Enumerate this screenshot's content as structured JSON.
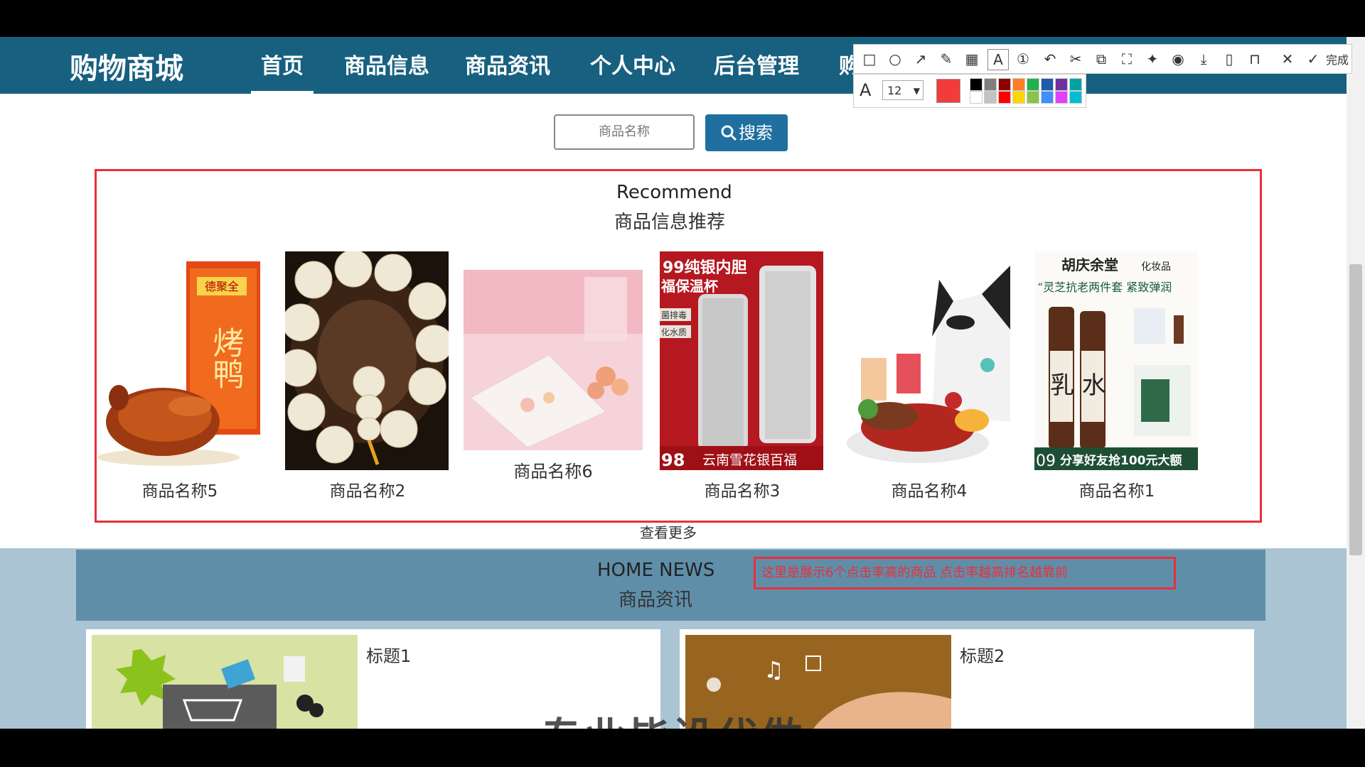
{
  "nav": {
    "logo": "购物商城",
    "items": [
      "首页",
      "商品信息",
      "商品资讯",
      "个人中心",
      "后台管理",
      "购"
    ]
  },
  "search": {
    "placeholder": "商品名称",
    "button_label": "搜索"
  },
  "recommend": {
    "title_en": "Recommend",
    "title_cn": "商品信息推荐",
    "products": [
      {
        "name": "商品名称5",
        "image": "roast-duck"
      },
      {
        "name": "商品名称2",
        "image": "bead-bracelet"
      },
      {
        "name": "商品名称6",
        "image": "pink-dessert"
      },
      {
        "name": "商品名称3",
        "image": "silver-thermos"
      },
      {
        "name": "商品名称4",
        "image": "snack-cat"
      },
      {
        "name": "商品名称1",
        "image": "cosmetics"
      }
    ],
    "more_label": "查看更多"
  },
  "product_text": {
    "duck_box": "烤鸭",
    "duck_brand": "德聚全",
    "thermos_top": "99纯银内胆",
    "thermos_sub": "福保温杯",
    "thermos_tag1": "菌排毒",
    "thermos_tag2": "化水质",
    "thermos_bottom": "云南雪花银百福",
    "thermos_price": "98",
    "cosmetics_brand": "胡庆余堂",
    "cosmetics_cat": "化妆品",
    "cosmetics_slogan": "“灵芝抗老两件套 紧致弹润",
    "cosmetics_label": "乳 水",
    "cosmetics_promo": "分享好友抢100元大额",
    "cosmetics_num": "09"
  },
  "news": {
    "title_en": "HOME NEWS",
    "title_cn": "商品资讯",
    "annotation": "这里是展示6个点击率高的商品 点击率越高排名越靠前",
    "cards": [
      {
        "title": "标题1",
        "image": "shopping-cart-illustration"
      },
      {
        "title": "标题2",
        "image": "hand-with-icons"
      }
    ],
    "overlay_text": "专业毕设代做"
  },
  "toolbar": {
    "icons": [
      "rectangle-icon",
      "circle-icon",
      "arrow-icon",
      "pencil-icon",
      "mosaic-icon",
      "text-icon",
      "number-icon",
      "undo-icon",
      "cut-icon",
      "copy-icon",
      "fullscreen-icon",
      "pin-icon",
      "record-icon",
      "download-icon",
      "save-icon",
      "bookmark-icon",
      "close-icon"
    ],
    "done_label": "完成",
    "font_size": "12",
    "selected_color": "#f23b3b",
    "palette": [
      "#000000",
      "#7f7f7f",
      "#8b0000",
      "#ff7f27",
      "#22b14c",
      "#1e5aa8",
      "#7030a0",
      "#00a2a2",
      "#ffffff",
      "#c3c3c3",
      "#ff0000",
      "#ffd700",
      "#8bc34a",
      "#3f8fff",
      "#e040fb",
      "#00bcd4"
    ]
  }
}
